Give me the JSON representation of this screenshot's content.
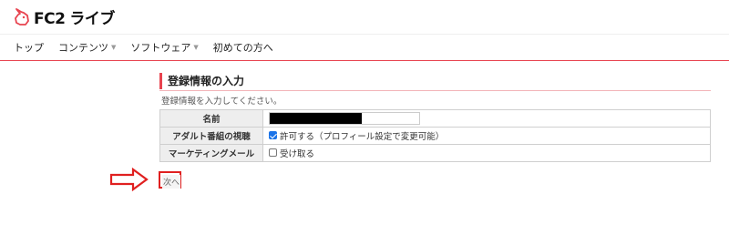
{
  "brand": {
    "logo_text": "FC2",
    "logo_jp": "ライブ",
    "accent": "#e8434f"
  },
  "nav": {
    "items": [
      {
        "label": "トップ",
        "dropdown": false
      },
      {
        "label": "コンテンツ",
        "dropdown": true
      },
      {
        "label": "ソフトウェア",
        "dropdown": true
      },
      {
        "label": "初めての方へ",
        "dropdown": false
      }
    ]
  },
  "form": {
    "title": "登録情報の入力",
    "instruction": "登録情報を入力してください。",
    "rows": {
      "name_label": "名前",
      "adult_label": "アダルト番組の視聴",
      "adult_option": "許可する（プロフィール設定で変更可能）",
      "adult_checked": true,
      "mail_label": "マーケティングメール",
      "mail_option": "受け取る",
      "mail_checked": false
    },
    "next_label": "次へ",
    "annotation_color": "#e02020"
  }
}
